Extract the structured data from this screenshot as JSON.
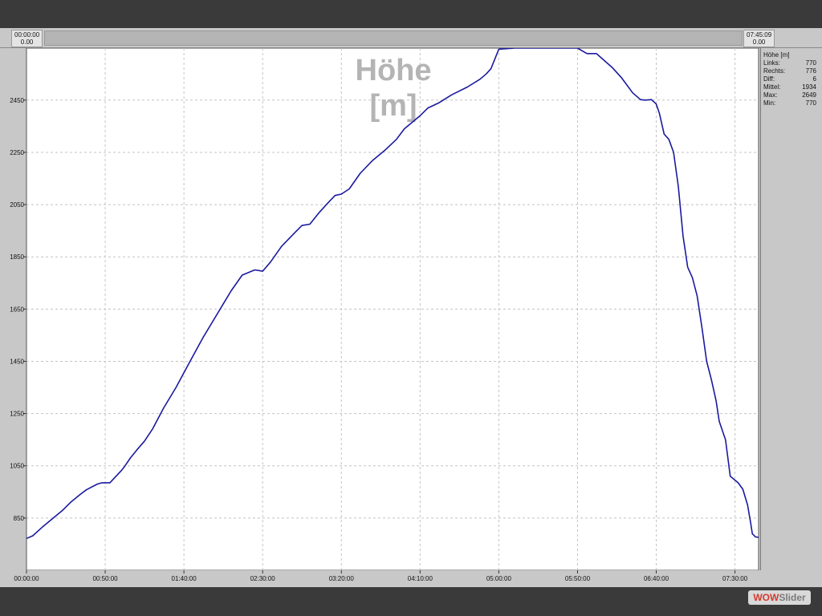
{
  "header": {
    "left_time": "00:00:00",
    "left_value": "0.00",
    "right_time": "07:45:09",
    "right_value": "0.00"
  },
  "stats": {
    "title": "Höhe [m]",
    "rows": [
      {
        "key": "Links:",
        "value": "770"
      },
      {
        "key": "Rechts:",
        "value": "776"
      },
      {
        "key": "Diff:",
        "value": "6"
      },
      {
        "key": "Mittel:",
        "value": "1934"
      },
      {
        "key": "Max:",
        "value": "2649"
      },
      {
        "key": "Min:",
        "value": "770"
      }
    ]
  },
  "logo": {
    "part1": "WOW",
    "part2": "Slider"
  },
  "colors": {
    "line": "#1a1aa0",
    "grid": "#c4c4c4",
    "title": "#b4b4b4"
  },
  "chart_data": {
    "type": "line",
    "title": "Höhe [m]",
    "title_lines": [
      "Höhe",
      "[m]"
    ],
    "xlabel": "",
    "ylabel": "",
    "x_unit": "minutes",
    "xlim": [
      0,
      465
    ],
    "ylim": [
      650,
      2649
    ],
    "y_ticks": [
      850,
      1050,
      1250,
      1450,
      1650,
      1850,
      2050,
      2250,
      2450
    ],
    "x_ticks": [
      {
        "value": 0,
        "label": "00:00:00"
      },
      {
        "value": 50,
        "label": "00:50:00"
      },
      {
        "value": 100,
        "label": "01:40:00"
      },
      {
        "value": 150,
        "label": "02:30:00"
      },
      {
        "value": 200,
        "label": "03:20:00"
      },
      {
        "value": 250,
        "label": "04:10:00"
      },
      {
        "value": 300,
        "label": "05:00:00"
      },
      {
        "value": 350,
        "label": "05:50:00"
      },
      {
        "value": 400,
        "label": "06:40:00"
      },
      {
        "value": 450,
        "label": "07:30:00"
      }
    ],
    "grid": true,
    "series": [
      {
        "x": [
          0,
          4,
          10,
          17,
          23,
          28,
          34,
          38,
          45,
          48,
          53,
          60,
          62,
          66,
          70,
          75,
          80,
          87,
          95,
          103,
          112,
          120,
          125,
          130,
          137,
          145,
          150,
          155,
          162,
          170,
          175,
          180,
          186,
          192,
          196,
          200,
          205,
          212,
          220,
          228,
          235,
          240,
          245,
          250,
          255,
          262,
          270,
          280,
          288,
          292,
          295,
          300,
          310,
          320,
          330,
          340,
          350,
          356,
          362,
          365,
          372,
          378,
          385,
          390,
          393,
          397,
          400,
          402,
          405,
          408,
          411,
          414,
          417,
          420,
          423,
          426,
          429,
          432,
          435,
          438,
          440,
          444,
          447,
          452,
          455,
          458,
          460,
          461,
          463,
          465
        ],
        "y": [
          772,
          782,
          815,
          850,
          880,
          910,
          940,
          958,
          980,
          985,
          985,
          1030,
          1045,
          1080,
          1110,
          1145,
          1190,
          1270,
          1350,
          1440,
          1540,
          1620,
          1670,
          1720,
          1780,
          1800,
          1795,
          1830,
          1890,
          1940,
          1970,
          1975,
          2020,
          2060,
          2085,
          2090,
          2110,
          2170,
          2220,
          2260,
          2300,
          2340,
          2365,
          2390,
          2420,
          2440,
          2470,
          2500,
          2530,
          2550,
          2570,
          2645,
          2649,
          2649,
          2649,
          2649,
          2649,
          2628,
          2628,
          2612,
          2575,
          2535,
          2478,
          2452,
          2450,
          2452,
          2435,
          2400,
          2320,
          2300,
          2250,
          2120,
          1930,
          1810,
          1770,
          1700,
          1580,
          1450,
          1380,
          1300,
          1220,
          1150,
          1010,
          985,
          960,
          900,
          830,
          790,
          778,
          776
        ]
      }
    ]
  }
}
